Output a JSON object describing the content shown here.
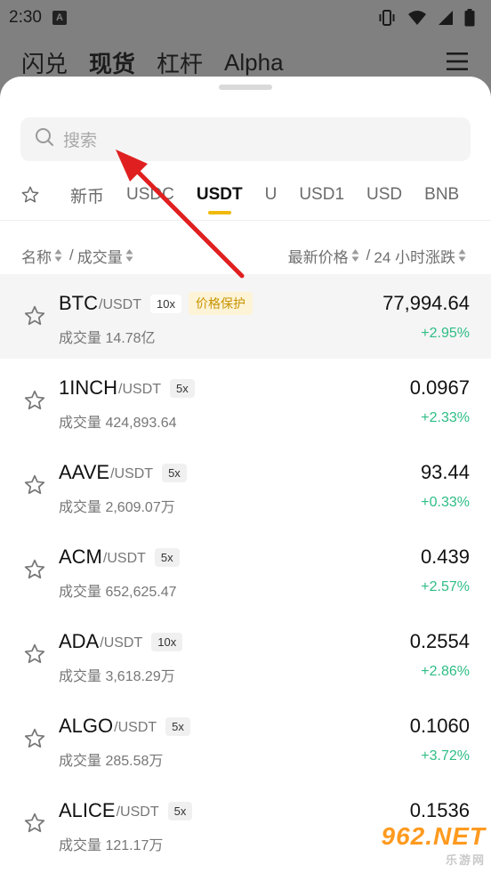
{
  "status_bar": {
    "time": "2:30",
    "badge": "A"
  },
  "header_tabs": [
    {
      "label": "闪兑"
    },
    {
      "label": "现货"
    },
    {
      "label": "杠杆"
    },
    {
      "label": "Alpha"
    }
  ],
  "search": {
    "placeholder": "搜索"
  },
  "quote_tabs": [
    {
      "label": "新币"
    },
    {
      "label": "USDC"
    },
    {
      "label": "USDT"
    },
    {
      "label": "U"
    },
    {
      "label": "USD1"
    },
    {
      "label": "USD"
    },
    {
      "label": "BNB"
    }
  ],
  "active_quote_tab": "USDT",
  "columns": {
    "name": "名称",
    "volume": "成交量",
    "price": "最新价格",
    "change": "24 小时涨跌",
    "separator": "/"
  },
  "rows": [
    {
      "base": "BTC",
      "quote": "/USDT",
      "leverage": "10x",
      "tag": "价格保护",
      "volume": "成交量 14.78亿",
      "price": "77,994.64",
      "change": "+2.95%"
    },
    {
      "base": "1INCH",
      "quote": "/USDT",
      "leverage": "5x",
      "volume": "成交量 424,893.64",
      "price": "0.0967",
      "change": "+2.33%"
    },
    {
      "base": "AAVE",
      "quote": "/USDT",
      "leverage": "5x",
      "volume": "成交量 2,609.07万",
      "price": "93.44",
      "change": "+0.33%"
    },
    {
      "base": "ACM",
      "quote": "/USDT",
      "leverage": "5x",
      "volume": "成交量 652,625.47",
      "price": "0.439",
      "change": "+2.57%"
    },
    {
      "base": "ADA",
      "quote": "/USDT",
      "leverage": "10x",
      "volume": "成交量 3,618.29万",
      "price": "0.2554",
      "change": "+2.86%"
    },
    {
      "base": "ALGO",
      "quote": "/USDT",
      "leverage": "5x",
      "volume": "成交量 285.58万",
      "price": "0.1060",
      "change": "+3.72%"
    },
    {
      "base": "ALICE",
      "quote": "/USDT",
      "leverage": "5x",
      "volume": "成交量 121.17万",
      "price": "0.1536",
      "change": ""
    }
  ],
  "watermark": {
    "top": "962.NET",
    "bottom": "乐游网"
  },
  "colors": {
    "accent": "#f0b90b",
    "positive": "#2ebd85",
    "annotation": "#e02020",
    "tag_text": "#c99400"
  }
}
